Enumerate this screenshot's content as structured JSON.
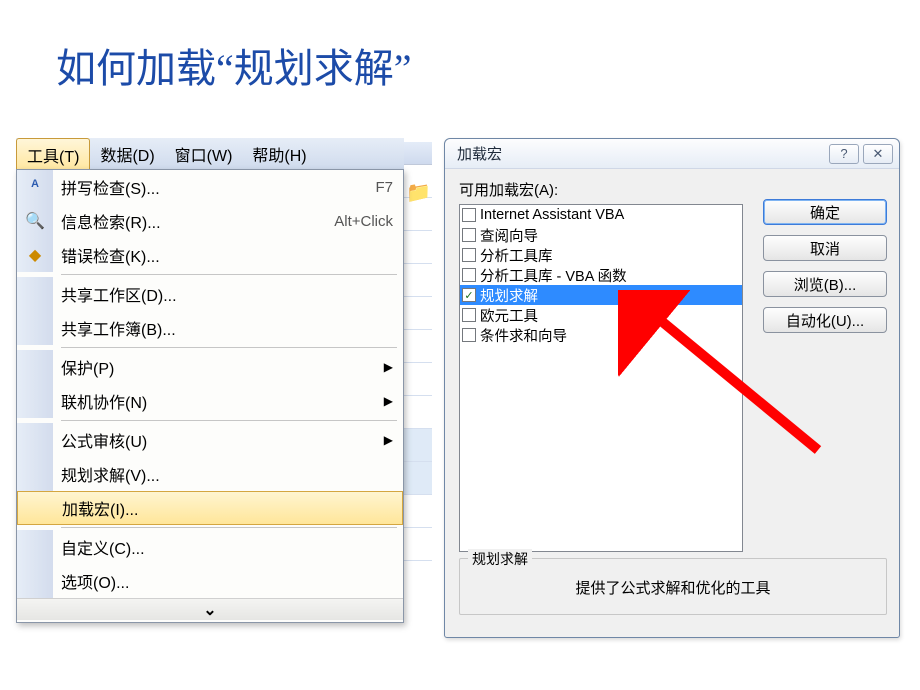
{
  "title": "如何加载“规划求解”",
  "menubar": {
    "items": [
      {
        "label": "工具(T)",
        "active": true
      },
      {
        "label": "数据(D)"
      },
      {
        "label": "窗口(W)"
      },
      {
        "label": "帮助(H)"
      }
    ]
  },
  "dropdown": {
    "groups": [
      [
        {
          "label": "拼写检查(S)...",
          "shortcut": "F7",
          "icon": "spellcheck-icon"
        },
        {
          "label": "信息检索(R)...",
          "shortcut": "Alt+Click",
          "icon": "research-icon"
        },
        {
          "label": "错误检查(K)...",
          "icon": "errorcheck-icon"
        }
      ],
      [
        {
          "label": "共享工作区(D)..."
        },
        {
          "label": "共享工作簿(B)..."
        }
      ],
      [
        {
          "label": "保护(P)",
          "submenu": true
        },
        {
          "label": "联机协作(N)",
          "submenu": true
        }
      ],
      [
        {
          "label": "公式审核(U)",
          "submenu": true
        },
        {
          "label": "规划求解(V)..."
        },
        {
          "label": "加载宏(I)...",
          "highlight": true
        }
      ],
      [
        {
          "label": "自定义(C)..."
        },
        {
          "label": "选项(O)..."
        }
      ]
    ],
    "expand_glyph": "⌄"
  },
  "dialog": {
    "title": "加载宏",
    "help_glyph": "?",
    "close_glyph": "✕",
    "available_label": "可用加载宏(A):",
    "items": [
      {
        "label": "Internet Assistant VBA",
        "checked": false
      },
      {
        "label": "查阅向导",
        "checked": false
      },
      {
        "label": "分析工具库",
        "checked": false
      },
      {
        "label": "分析工具库 - VBA 函数",
        "checked": false
      },
      {
        "label": "规划求解",
        "checked": true,
        "selected": true
      },
      {
        "label": "欧元工具",
        "checked": false
      },
      {
        "label": "条件求和向导",
        "checked": false
      }
    ],
    "buttons": {
      "ok": "确定",
      "cancel": "取消",
      "browse": "浏览(B)...",
      "automation": "自动化(U)..."
    },
    "detail_title": "规划求解",
    "detail_desc": "提供了公式求解和优化的工具"
  }
}
